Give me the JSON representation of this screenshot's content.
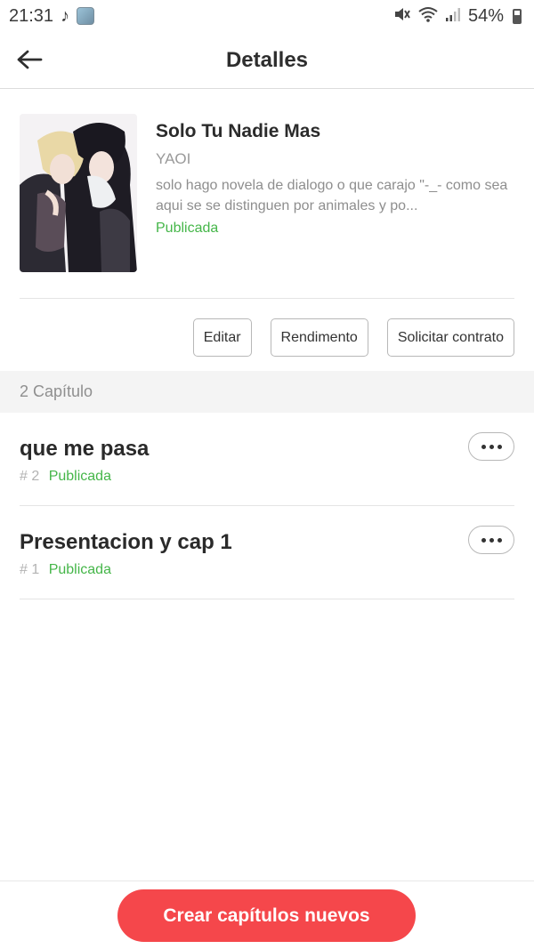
{
  "status_bar": {
    "time": "21:31",
    "battery": "54%",
    "icons": [
      "tiktok-icon",
      "app-icon",
      "mute-icon",
      "wifi-icon",
      "signal-icon",
      "battery-icon"
    ]
  },
  "header": {
    "title": "Detalles",
    "back_icon": "arrow-left-icon"
  },
  "book": {
    "title": "Solo Tu Nadie Mas",
    "genre": "YAOI",
    "description": "solo hago novela de dialogo o que carajo \"-_- como sea aqui se se distinguen por animales y po...",
    "status": "Publicada"
  },
  "actions": {
    "edit": "Editar",
    "performance": "Rendimento",
    "request_contract": "Solicitar contrato"
  },
  "chapters_header": "2 Capítulo",
  "chapters": [
    {
      "title": "que me pasa",
      "number": "# 2",
      "status": "Publicada"
    },
    {
      "title": "Presentacion y cap 1",
      "number": "# 1",
      "status": "Publicada"
    }
  ],
  "create_button": "Crear capítulos nuevos",
  "colors": {
    "accent": "#f5474b",
    "published": "#45b649",
    "muted_text": "#8e8e8e"
  }
}
